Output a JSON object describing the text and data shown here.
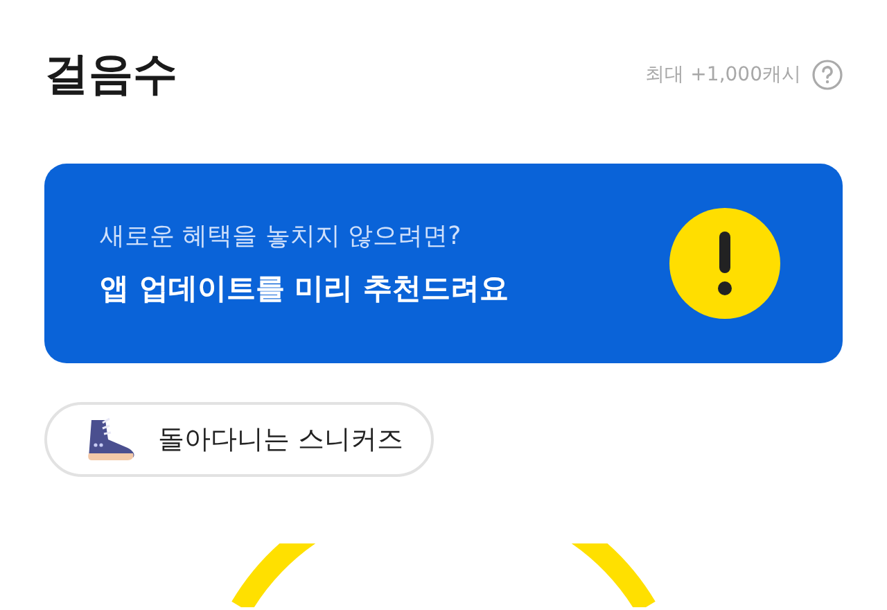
{
  "header": {
    "title": "걸음수",
    "reward": "최대 +1,000캐시"
  },
  "banner": {
    "subtitle": "새로운 혜택을 놓치지 않으려면?",
    "title": "앱 업데이트를 미리 추천드려요"
  },
  "chip": {
    "label": "돌아다니는 스니커즈"
  }
}
